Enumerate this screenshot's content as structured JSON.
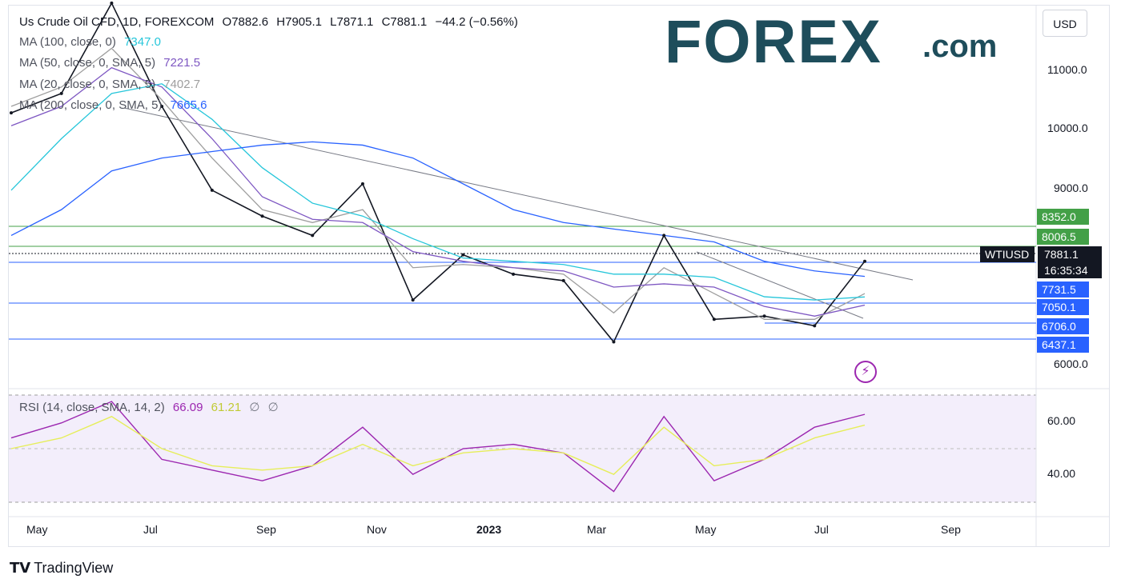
{
  "header": {
    "symbol": "Us Crude Oil CFD, 1D, FOREXCOM",
    "open": "O7882.6",
    "high": "H7905.1",
    "low": "L7871.1",
    "close": "C7881.1",
    "change": "−44.2 (−0.56%)"
  },
  "indicators": [
    {
      "label": "MA (100, close, 0)",
      "value": "7347.0",
      "color": "#26c6da"
    },
    {
      "label": "MA (50, close, 0, SMA, 5)",
      "value": "7221.5",
      "color": "#7e57c2"
    },
    {
      "label": "MA (20, close, 0, SMA, 5)",
      "value": "7402.7",
      "color": "#9e9e9e"
    },
    {
      "label": "MA (200, close, 0, SMA, 5)",
      "value": "7665.6",
      "color": "#2962ff"
    }
  ],
  "currency_button": "USD",
  "logo": {
    "brand": "FOREX",
    "suffix": ".com"
  },
  "price_axis": [
    "11000.0",
    "10000.0",
    "9000.0",
    "6000.0"
  ],
  "levels": [
    {
      "value": "8352.0",
      "color": "#43a047"
    },
    {
      "value": "8006.5",
      "color": "#43a047"
    },
    {
      "value": "7731.5",
      "color": "#2962ff"
    },
    {
      "value": "7050.1",
      "color": "#2962ff"
    },
    {
      "value": "6706.0",
      "color": "#2962ff"
    },
    {
      "value": "6437.1",
      "color": "#2962ff"
    }
  ],
  "last_price": {
    "ticker": "WTIUSD",
    "price": "7881.1",
    "countdown": "16:35:34"
  },
  "rsi": {
    "label": "RSI (14, close, SMA, 14, 2)",
    "value": "66.09",
    "sma": "61.21",
    "extra1": "∅",
    "extra2": "∅",
    "axis": [
      "60.00",
      "40.00"
    ]
  },
  "time_axis": [
    "May",
    "Jul",
    "Sep",
    "Nov",
    "2023",
    "Mar",
    "May",
    "Jul",
    "Sep"
  ],
  "footer": "TradingView",
  "colors": {
    "up": "#131722",
    "down": "#131722",
    "rsi": "#9c27b0",
    "rsi_sma": "#e6ee5a",
    "ma100": "#26c6da",
    "ma50": "#7e57c2",
    "ma20": "#9e9e9e",
    "ma200": "#2962ff"
  },
  "chart_data": {
    "type": "line",
    "title": "Us Crude Oil CFD, 1D, FOREXCOM",
    "x": [
      "2022-04-20",
      "2022-05-15",
      "2022-06-10",
      "2022-07-05",
      "2022-08-01",
      "2022-09-01",
      "2022-10-01",
      "2022-11-01",
      "2022-12-01",
      "2023-01-01",
      "2023-02-01",
      "2023-03-01",
      "2023-03-20",
      "2023-04-12",
      "2023-05-01",
      "2023-06-01",
      "2023-07-01",
      "2023-07-20"
    ],
    "series": [
      {
        "values": [
          10200,
          10500,
          11900,
          10300,
          9000,
          8600,
          8300,
          9100,
          7300,
          8000,
          7700,
          7600,
          6650,
          8300,
          7000,
          7050,
          6900,
          7900
        ]
      },
      {
        "values": [
          10300,
          10600,
          11200,
          10400,
          9500,
          8700,
          8500,
          8700,
          7800,
          7850,
          7800,
          7700,
          7100,
          7800,
          7400,
          7000,
          7000,
          7400
        ]
      },
      {
        "values": [
          10000,
          10300,
          10900,
          10600,
          9800,
          8900,
          8550,
          8500,
          8050,
          7900,
          7800,
          7750,
          7500,
          7550,
          7500,
          7200,
          7050,
          7221
        ]
      },
      {
        "values": [
          9000,
          9800,
          10500,
          10650,
          10100,
          9350,
          8800,
          8600,
          8250,
          7950,
          7900,
          7850,
          7700,
          7700,
          7650,
          7350,
          7300,
          7347
        ]
      },
      {
        "values": [
          8300,
          8700,
          9300,
          9500,
          9600,
          9700,
          9750,
          9700,
          9500,
          9100,
          8700,
          8500,
          8400,
          8300,
          8200,
          7900,
          7750,
          7665
        ]
      }
    ],
    "ylim": [
      6000,
      11800
    ],
    "rsi": {
      "values": [
        55,
        62,
        72,
        45,
        40,
        35,
        42,
        60,
        38,
        50,
        52,
        48,
        30,
        65,
        35,
        45,
        60,
        66
      ],
      "sma": [
        50,
        55,
        65,
        50,
        42,
        40,
        42,
        52,
        42,
        48,
        50,
        48,
        38,
        60,
        42,
        45,
        55,
        61
      ],
      "ylim": [
        25,
        75
      ]
    }
  }
}
